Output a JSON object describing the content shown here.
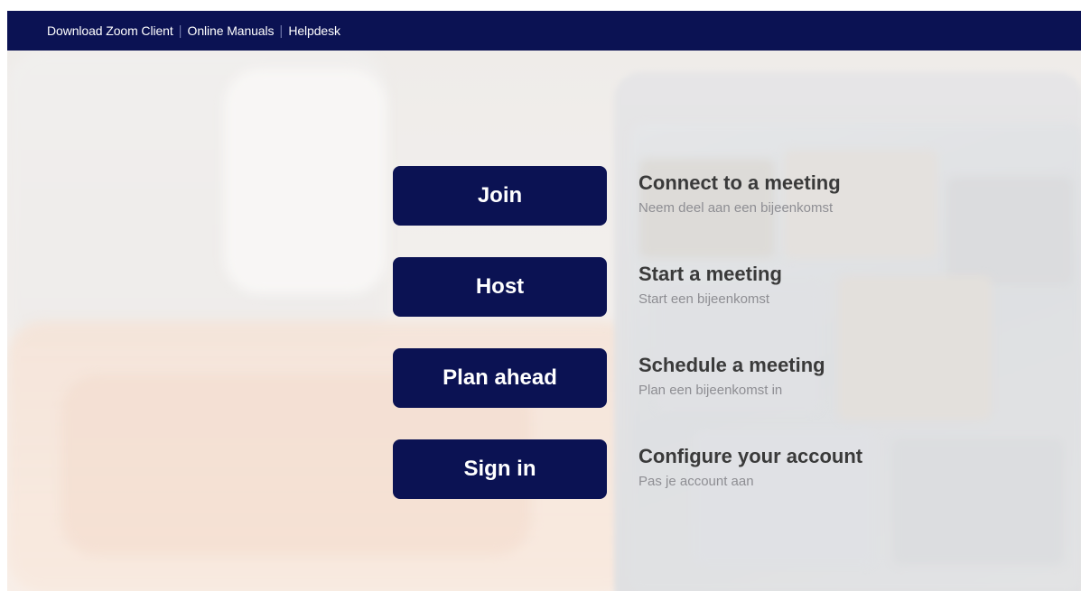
{
  "topnav": {
    "links": [
      {
        "label": "Download Zoom Client"
      },
      {
        "label": "Online Manuals"
      },
      {
        "label": "Helpdesk"
      }
    ],
    "separator": "|"
  },
  "actions": [
    {
      "button": "Join",
      "title": "Connect to a meeting",
      "subtitle": "Neem deel aan een bijeenkomst"
    },
    {
      "button": "Host",
      "title": "Start a meeting",
      "subtitle": "Start een bijeenkomst"
    },
    {
      "button": "Plan ahead",
      "title": "Schedule a meeting",
      "subtitle": "Plan een bijeenkomst in"
    },
    {
      "button": "Sign in",
      "title": "Configure your account",
      "subtitle": "Pas je account aan"
    }
  ],
  "colors": {
    "navy": "#0b1253",
    "title_text": "#3a3a3a",
    "subtitle_text": "#8e8e93"
  }
}
